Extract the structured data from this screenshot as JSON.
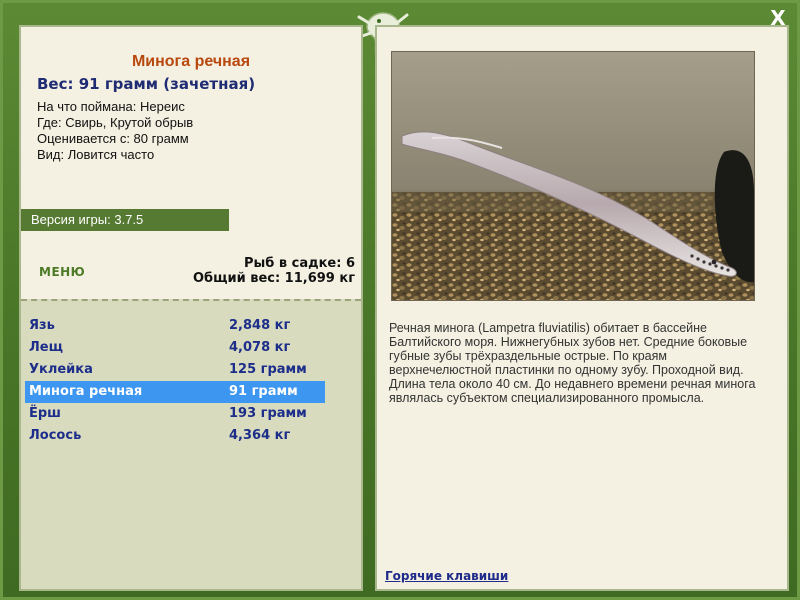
{
  "window": {
    "close_label": "X"
  },
  "fish": {
    "title": "Минога речная",
    "weight_line": "Вес: 91 грамм (зачетная)",
    "details": [
      "На что поймана: Нереис",
      "Где: Свирь, Крутой обрыв",
      "Оценивается с: 80 грамм",
      "Вид: Ловится часто"
    ],
    "description": "Речная минога (Lampetra fluviatilis) обитает в бассейне Балтийского моря. Нижнегубных зубов нет. Средние боковые губные зубы трёхраздельные острые. По краям верхнечелюстной пластинки по одному зубу. Проходной вид. Длина тела около 40 см. До недавнего времени речная минога являлась субъектом специализированного промысла."
  },
  "version": {
    "label": "Версия игры: 3.7.5"
  },
  "menu": {
    "label": "МЕНЮ"
  },
  "keepnet": {
    "count_line": "Рыб в садке: 6",
    "total_line": "Общий вес: 11,699 кг"
  },
  "catch_list": [
    {
      "name": "Язь",
      "weight": "2,848 кг",
      "selected": false
    },
    {
      "name": "Лещ",
      "weight": "4,078 кг",
      "selected": false
    },
    {
      "name": "Уклейка",
      "weight": "125 грамм",
      "selected": false
    },
    {
      "name": "Минога речная",
      "weight": "91 грамм",
      "selected": true
    },
    {
      "name": "Ёрш",
      "weight": "193 грамм",
      "selected": false
    },
    {
      "name": "Лосось",
      "weight": "4,364 кг",
      "selected": false
    }
  ],
  "footer": {
    "hotkeys_label": "Горячие клавиши"
  },
  "icons": {
    "logo": "lizard-logo-icon",
    "close": "close-icon"
  },
  "colors": {
    "frame_green": "#4f7c2c",
    "panel_bg": "#f4f1e2",
    "list_bg": "#d9dbbf",
    "title_orange": "#b8480e",
    "text_blue": "#1c2e8a",
    "selected_bg": "#3d96f0"
  }
}
